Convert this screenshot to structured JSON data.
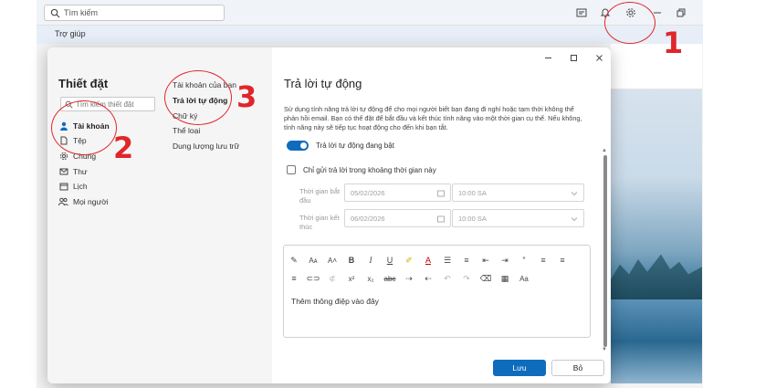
{
  "topbar": {
    "search_placeholder": "Tìm kiếm",
    "icons": [
      "calendar-note-icon",
      "bell-icon",
      "gear-icon",
      "minimize-icon",
      "restore-icon"
    ]
  },
  "menubar": {
    "help": "Trợ giúp"
  },
  "settings": {
    "title": "Thiết đặt",
    "search_placeholder": "Tìm kiếm thiết đặt",
    "nav": [
      {
        "label": "Tài khoản",
        "icon": "person-icon",
        "active": true
      },
      {
        "label": "Tệp",
        "icon": "document-icon",
        "active": false
      },
      {
        "label": "Chung",
        "icon": "gear-icon",
        "active": false
      },
      {
        "label": "Thư",
        "icon": "mail-icon",
        "active": false
      },
      {
        "label": "Lịch",
        "icon": "calendar-icon",
        "active": false
      },
      {
        "label": "Mọi người",
        "icon": "people-icon",
        "active": false
      }
    ],
    "subnav": [
      {
        "label": "Tài khoản của bạn",
        "active": false
      },
      {
        "label": "Trả lời tự động",
        "active": true
      },
      {
        "label": "Chữ ký",
        "active": false
      },
      {
        "label": "Thể loại",
        "active": false
      },
      {
        "label": "Dung lượng lưu trữ",
        "active": false
      }
    ]
  },
  "content": {
    "title": "Trả lời tự động",
    "description": "Sử dụng tính năng trả lời tự động để cho mọi người biết bạn đang đi nghỉ hoặc tạm thời không thể phản hồi email. Bạn có thể đặt để bắt đầu và kết thúc tính năng vào một thời gian cụ thể. Nếu không, tính năng này sẽ tiếp tục hoạt động cho đến khi bạn tắt.",
    "toggle_label": "Trả lời tự động đang bật",
    "toggle_on": true,
    "range_checkbox_label": "Chỉ gửi trả lời trong khoảng thời gian này",
    "start_label": "Thời gian bắt đầu",
    "start_date": "05/02/2026",
    "start_time": "10:00 SA",
    "end_label": "Thời gian kết thúc",
    "end_date": "06/02/2026",
    "end_time": "10:00 SA",
    "editor_placeholder": "Thêm thông điệp vào đây"
  },
  "footer": {
    "save": "Lưu",
    "cancel": "Bỏ"
  },
  "annotations": {
    "n1": "1",
    "n2": "2",
    "n3": "3",
    "color": "#e0262b"
  },
  "colors": {
    "accent": "#0f6cbd"
  }
}
